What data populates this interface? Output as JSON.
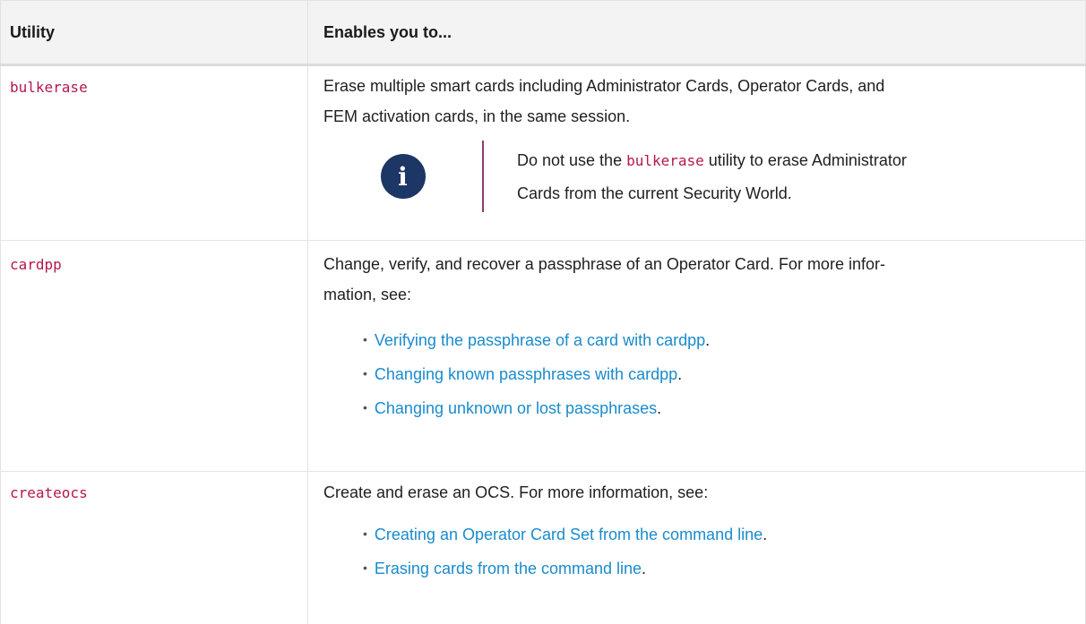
{
  "header": {
    "col1": "Utility",
    "col2": "Enables you to..."
  },
  "rows": [
    {
      "utility": "bulkerase",
      "desc_line1": "Erase multiple smart cards including Administrator Cards, Operator Cards, and",
      "desc_line2": "FEM activation cards, in the same session.",
      "note": {
        "icon": "info-icon",
        "pre": "Do not use the ",
        "code": "bulkerase",
        "post_line1": " utility to erase Administrator",
        "line2": "Cards from the current Security World."
      }
    },
    {
      "utility": "cardpp",
      "desc_line1": "Change, verify, and recover a passphrase of an Operator Card. For more infor-",
      "desc_line2": "mation, see:",
      "links": [
        "Verifying the passphrase of a card with cardpp",
        "Changing known passphrases with cardpp",
        "Changing unknown or lost passphrases"
      ]
    },
    {
      "utility": "createocs",
      "desc_line1": "Create and erase an OCS. For more information, see:",
      "links": [
        "Creating an Operator Card Set from the command line",
        "Erasing cards from the command line"
      ]
    }
  ],
  "colors": {
    "code": "#b5174a",
    "link": "#1a8bcc",
    "note_icon_bg": "#1c3665",
    "note_bar": "#8e3a78",
    "header_bg": "#f3f3f3"
  }
}
